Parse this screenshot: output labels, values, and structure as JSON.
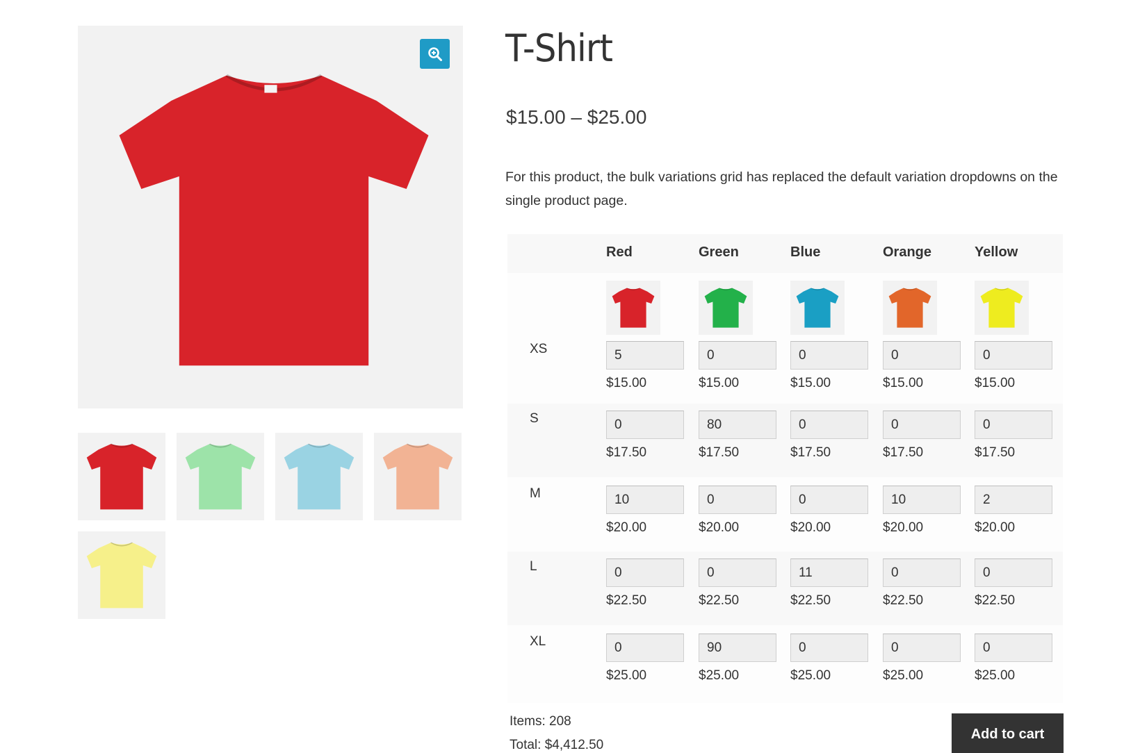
{
  "product": {
    "title": "T-Shirt",
    "price_range": "$15.00 – $25.00",
    "description": "For this product, the bulk variations grid has replaced the default variation dropdowns on the single product page."
  },
  "gallery": {
    "main_color": "#d8232a",
    "zoom_icon": "zoom-in-icon",
    "thumbnails": [
      {
        "color": "#d8232a"
      },
      {
        "color": "#9de3a9"
      },
      {
        "color": "#9ad3e3"
      },
      {
        "color": "#f2b394"
      },
      {
        "color": "#f6f08a"
      }
    ]
  },
  "grid": {
    "columns": [
      {
        "label": "Red",
        "color": "#d8232a"
      },
      {
        "label": "Green",
        "color": "#23b14a"
      },
      {
        "label": "Blue",
        "color": "#1a9fc4"
      },
      {
        "label": "Orange",
        "color": "#e2662a"
      },
      {
        "label": "Yellow",
        "color": "#eeec1f"
      }
    ],
    "rows": [
      {
        "label": "XS",
        "price": "$15.00",
        "quantities": [
          "5",
          "0",
          "0",
          "0",
          "0"
        ]
      },
      {
        "label": "S",
        "price": "$17.50",
        "quantities": [
          "0",
          "80",
          "0",
          "0",
          "0"
        ]
      },
      {
        "label": "M",
        "price": "$20.00",
        "quantities": [
          "10",
          "0",
          "0",
          "10",
          "2"
        ]
      },
      {
        "label": "L",
        "price": "$22.50",
        "quantities": [
          "0",
          "0",
          "11",
          "0",
          "0"
        ]
      },
      {
        "label": "XL",
        "price": "$25.00",
        "quantities": [
          "0",
          "90",
          "0",
          "0",
          "0"
        ]
      }
    ]
  },
  "summary": {
    "items": "Items: 208",
    "total": "Total: $4,412.50",
    "add_to_cart": "Add to cart"
  }
}
